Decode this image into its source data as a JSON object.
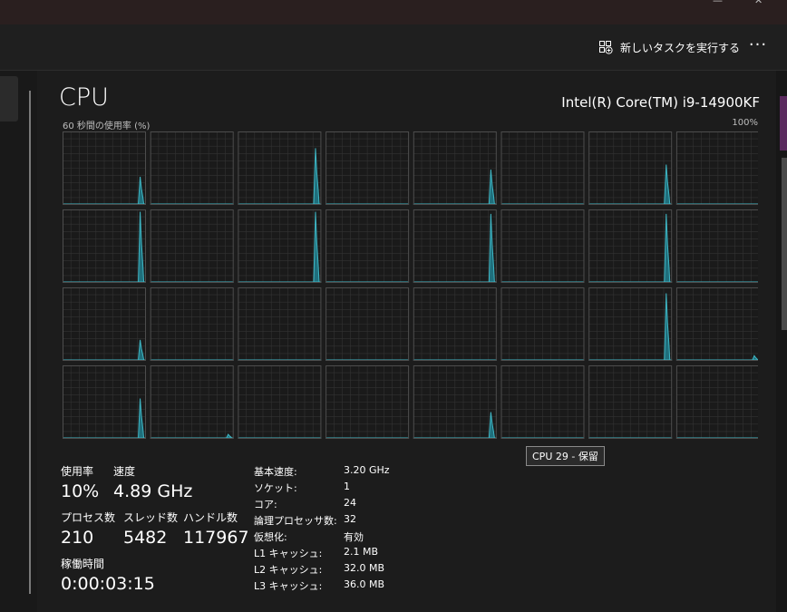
{
  "commandbar": {
    "new_task_label": "新しいタスクを実行する",
    "more_label": "···"
  },
  "cpu": {
    "title": "CPU",
    "model": "Intel(R) Core(TM) i9-14900KF",
    "usage_label": "60 秒間の使用率 (%)",
    "max_label": "100%",
    "tooltip": "CPU 29 - 保留"
  },
  "stats": [
    {
      "label": "使用率",
      "value": "10%"
    },
    {
      "label": "速度",
      "value": "4.89 GHz"
    },
    {
      "label": "プロセス数",
      "value": "210"
    },
    {
      "label": "スレッド数",
      "value": "5482"
    },
    {
      "label": "ハンドル数",
      "value": "117967"
    },
    {
      "label": "稼働時間",
      "value": "0:00:03:15"
    }
  ],
  "specs": [
    {
      "label": "基本速度:",
      "value": "3.20 GHz"
    },
    {
      "label": "ソケット:",
      "value": "1"
    },
    {
      "label": "コア:",
      "value": "24"
    },
    {
      "label": "論理プロセッサ数:",
      "value": "32"
    },
    {
      "label": "仮想化:",
      "value": "有効"
    },
    {
      "label": "L1 キャッシュ:",
      "value": "2.1 MB"
    },
    {
      "label": "L2 キャッシュ:",
      "value": "32.0 MB"
    },
    {
      "label": "L3 キャッシュ:",
      "value": "36.0 MB"
    }
  ],
  "colors": {
    "graph_line": "#3fb6c4",
    "graph_fill": "#1f6f7c",
    "grid": "#333333",
    "border": "#4d4d4d"
  },
  "cpu_graphs": [
    {
      "cpu": 0,
      "spike": 0.38
    },
    {
      "cpu": 1,
      "spike": 0.0
    },
    {
      "cpu": 2,
      "spike": 0.78
    },
    {
      "cpu": 3,
      "spike": 0.0
    },
    {
      "cpu": 4,
      "spike": 0.48
    },
    {
      "cpu": 5,
      "spike": 0.0
    },
    {
      "cpu": 6,
      "spike": 0.55
    },
    {
      "cpu": 7,
      "spike": 0.0
    },
    {
      "cpu": 8,
      "spike": 0.98
    },
    {
      "cpu": 9,
      "spike": 0.0
    },
    {
      "cpu": 10,
      "spike": 0.98
    },
    {
      "cpu": 11,
      "spike": 0.0
    },
    {
      "cpu": 12,
      "spike": 0.95
    },
    {
      "cpu": 13,
      "spike": 0.0
    },
    {
      "cpu": 14,
      "spike": 0.95
    },
    {
      "cpu": 15,
      "spike": 0.0
    },
    {
      "cpu": 16,
      "spike": 0.28
    },
    {
      "cpu": 17,
      "spike": 0.0
    },
    {
      "cpu": 18,
      "spike": 0.0
    },
    {
      "cpu": 19,
      "spike": 0.0
    },
    {
      "cpu": 20,
      "spike": 0.0
    },
    {
      "cpu": 21,
      "spike": 0.0
    },
    {
      "cpu": 22,
      "spike": 0.93
    },
    {
      "cpu": 23,
      "spike": 0.06,
      "late": true
    },
    {
      "cpu": 24,
      "spike": 0.55
    },
    {
      "cpu": 25,
      "spike": 0.05,
      "late": true
    },
    {
      "cpu": 26,
      "spike": 0.0
    },
    {
      "cpu": 27,
      "spike": 0.0
    },
    {
      "cpu": 28,
      "spike": 0.36
    },
    {
      "cpu": 29,
      "spike": 0.0
    },
    {
      "cpu": 30,
      "spike": 0.0
    },
    {
      "cpu": 31,
      "spike": 0.0
    }
  ]
}
